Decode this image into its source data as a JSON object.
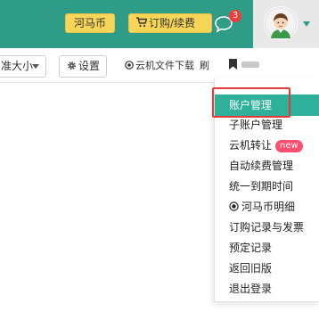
{
  "header": {
    "coin_button": "河马币",
    "order_button": "订购/续费",
    "message_badge_count": "3"
  },
  "toolbar": {
    "size_dropdown": "准大小",
    "settings_button": "设置",
    "download_link": "云机文件下载",
    "refresh_partial": "刷"
  },
  "menu": {
    "items": [
      {
        "label": "账户管理"
      },
      {
        "label": "子账户管理"
      },
      {
        "label": "云机转让",
        "badge": "new"
      },
      {
        "label": "自动续费管理"
      },
      {
        "label": "统一到期时间"
      },
      {
        "label": "河马币明细"
      },
      {
        "label": "订购记录与发票"
      },
      {
        "label": "预定记录"
      },
      {
        "label": "返回旧版"
      },
      {
        "label": "退出登录"
      }
    ]
  },
  "colors": {
    "header_bg": "#2f9c88",
    "active_item": "#2fb09a",
    "button_yellow": "#f7d657",
    "highlight_red": "#e33b3b",
    "badge_red": "#ef3b3b"
  }
}
